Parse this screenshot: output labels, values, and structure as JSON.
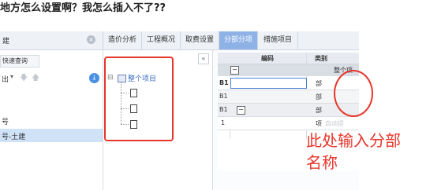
{
  "question_title": "地方怎么设置啊？我怎么插入不了??",
  "app": {
    "left_panel": {
      "header_text": "建",
      "quick_query": "快速查询",
      "toolbar_label": "出",
      "item_1": "号",
      "item_2": "号-土建"
    },
    "tabs": [
      {
        "label": "造价分析"
      },
      {
        "label": "工程概况"
      },
      {
        "label": "取费设置"
      },
      {
        "label": "分部分项"
      },
      {
        "label": "措施项目"
      }
    ],
    "tree": {
      "root_label": "整个项目",
      "collapse_sign": "⊟",
      "collapse_button": "«"
    },
    "grid": {
      "headers": [
        "编码",
        "类别"
      ],
      "top_section_label": "整个项",
      "rows": [
        {
          "code": "B1",
          "category": "部"
        },
        {
          "code": "B1",
          "category": "部"
        },
        {
          "code": "B1",
          "category": "部"
        },
        {
          "code": "1",
          "category": "项",
          "extra": "自动提"
        }
      ],
      "minus_sign": "−"
    }
  },
  "annotation": {
    "line1": "此处输入分部",
    "line2": "名称",
    "color": "#e8352a"
  }
}
